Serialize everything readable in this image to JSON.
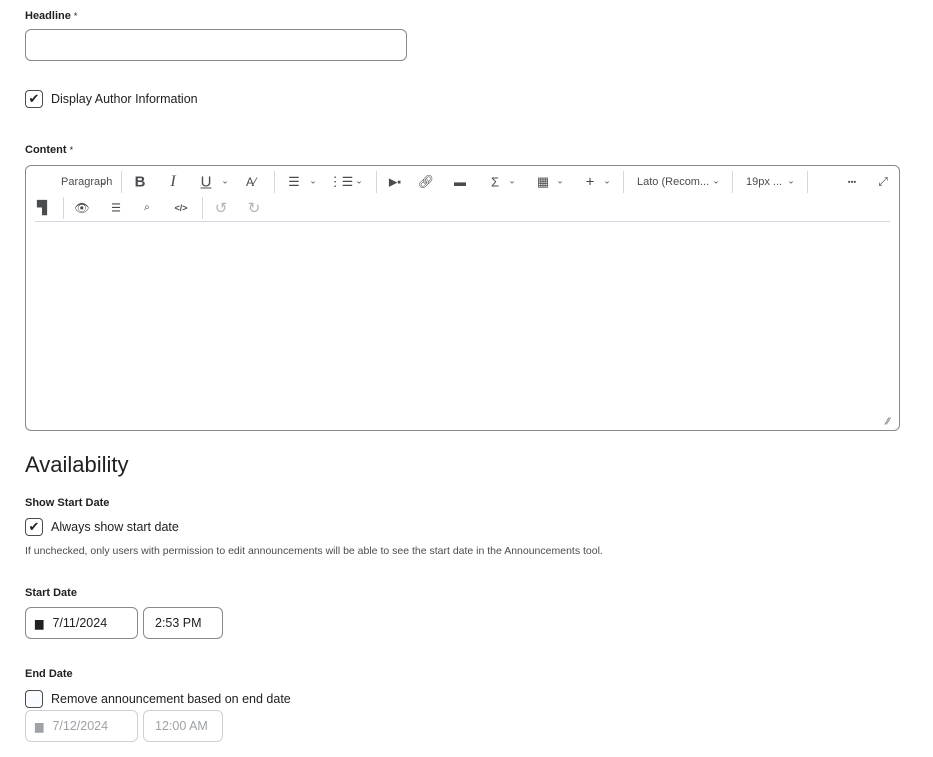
{
  "headline": {
    "label": "Headline",
    "required": "*",
    "value": ""
  },
  "display_author": {
    "label": "Display Author Information",
    "checked": true
  },
  "content": {
    "label": "Content",
    "required": "*",
    "toolbar": {
      "paragraph": "Paragraph",
      "bold": "B",
      "italic": "I",
      "underline": "U",
      "font": "Lato (Recom...",
      "size": "19px ...",
      "more": "•••"
    },
    "value": ""
  },
  "availability": {
    "title": "Availability",
    "show_start": {
      "label": "Show Start Date",
      "checkbox": "Always show start date",
      "checked": true,
      "help": "If unchecked, only users with permission to edit announcements will be able to see the start date in the Announcements tool."
    },
    "start": {
      "label": "Start Date",
      "date": "7/11/2024",
      "time": "2:53 PM"
    },
    "end": {
      "label": "End Date",
      "checkbox": "Remove announcement based on end date",
      "checked": false,
      "date": "7/12/2024",
      "time": "12:00 AM"
    }
  }
}
